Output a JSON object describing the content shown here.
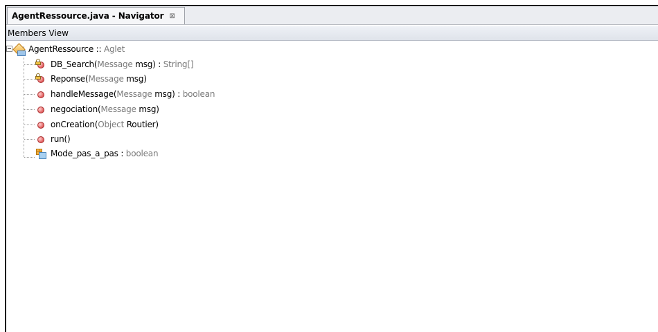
{
  "tab": {
    "title": "AgentRessource.java - Navigator",
    "close_glyph": "⊠"
  },
  "panel": {
    "header": "Members View"
  },
  "tree": {
    "root": {
      "name": "AgentRessource",
      "sep": " :: ",
      "type": "Aglet"
    },
    "members": [
      {
        "name": "DB_Search(",
        "p_type": "Message",
        "p_name": " msg)",
        "ret": " : ",
        "ret_type": "String[]",
        "icon": "lock-method-icon"
      },
      {
        "name": "Reponse(",
        "p_type": "Message",
        "p_name": " msg)",
        "ret": "",
        "ret_type": "",
        "icon": "lock-method-icon"
      },
      {
        "name": "handleMessage(",
        "p_type": "Message",
        "p_name": " msg)",
        "ret": " : ",
        "ret_type": "boolean",
        "icon": "method-icon"
      },
      {
        "name": "negociation(",
        "p_type": "Message",
        "p_name": " msg)",
        "ret": "",
        "ret_type": "",
        "icon": "method-icon"
      },
      {
        "name": "onCreation(",
        "p_type": "Object",
        "p_name": " Routier)",
        "ret": "",
        "ret_type": "",
        "icon": "method-icon"
      },
      {
        "name": "run()",
        "p_type": "",
        "p_name": "",
        "ret": "",
        "ret_type": "",
        "icon": "method-icon"
      }
    ],
    "field": {
      "name": "Mode_pas_a_pas",
      "sep": " : ",
      "type": "boolean"
    }
  }
}
